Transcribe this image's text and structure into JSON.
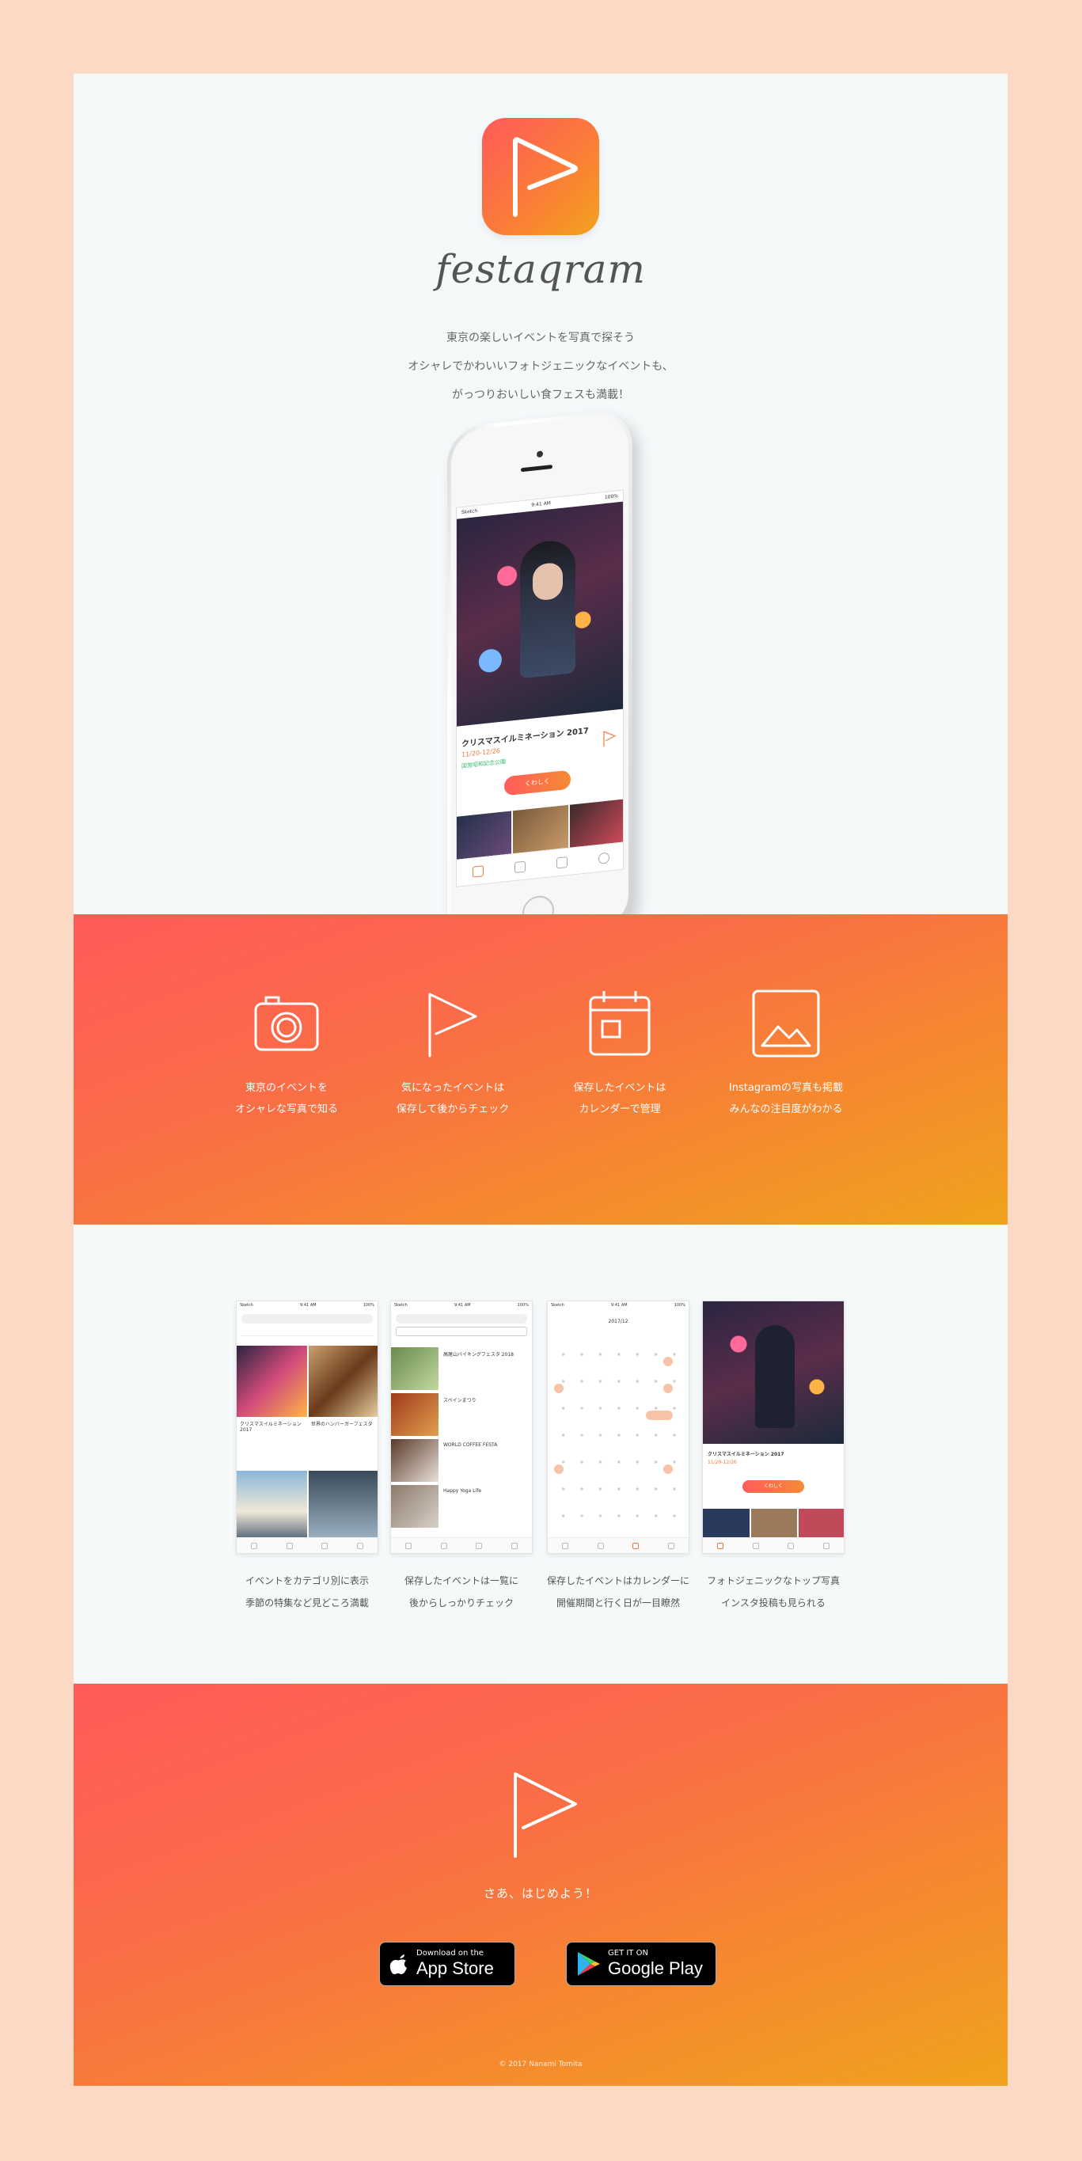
{
  "hero": {
    "app_name": "festaqram",
    "tagline": [
      "東京の楽しいイベントを写真で探そう",
      "オシャレでかわいいフォトジェニックなイベントも、",
      "がっつりおいしい食フェスも満載！"
    ],
    "phone": {
      "carrier": "Sketch",
      "time": "9:41 AM",
      "battery": "100%",
      "event_title": "クリスマスイルミネーション 2017",
      "event_date": "11/20-12/26",
      "event_place": "国営昭和記念公園",
      "detail_button": "くわしく"
    }
  },
  "features": [
    {
      "icon": "camera-icon",
      "lines": [
        "東京のイベントを",
        "オシャレな写真で知る"
      ]
    },
    {
      "icon": "flag-icon",
      "lines": [
        "気になったイベントは",
        "保存して後からチェック"
      ]
    },
    {
      "icon": "calendar-icon",
      "lines": [
        "保存したイベントは",
        "カレンダーで管理"
      ]
    },
    {
      "icon": "image-icon",
      "lines": [
        "Instagramの写真も掲載",
        "みんなの注目度がわかる"
      ]
    }
  ],
  "screens": [
    {
      "lines": [
        "イベントをカテゴリ別に表示",
        "季節の特集など見どころ満載"
      ],
      "items": [
        "クリスマスイルミネーション 2017",
        "世界のハンバーガーフェスタ"
      ]
    },
    {
      "lines": [
        "保存したイベントは一覧に",
        "後からしっかりチェック"
      ],
      "items": [
        "高尾山バイキングフェスタ 2018",
        "スペインまつり",
        "WORLD COFFEE FESTA",
        "Happy Yoga Life"
      ]
    },
    {
      "lines": [
        "保存したイベントはカレンダーに",
        "開催期間と行く日が一目瞭然"
      ],
      "month": "2017/12"
    },
    {
      "lines": [
        "フォトジェニックなトップ写真",
        "インスタ投稿も見られる"
      ],
      "title": "クリスマスイルミネーション 2017",
      "date": "11/20-12/26",
      "button": "くわしく"
    }
  ],
  "cta": {
    "text": "さあ、はじめよう！",
    "app_store": {
      "small": "Download on the",
      "big": "App Store"
    },
    "google_play": {
      "small": "GET IT ON",
      "big": "Google Play"
    }
  },
  "footer": {
    "copyright": "© 2017 Nanami Tomita"
  },
  "colors": {
    "background": "#fbd9c4",
    "gradient_start": "#ff5a5a",
    "gradient_end": "#f0a21c",
    "accent_green": "#39b86c"
  }
}
